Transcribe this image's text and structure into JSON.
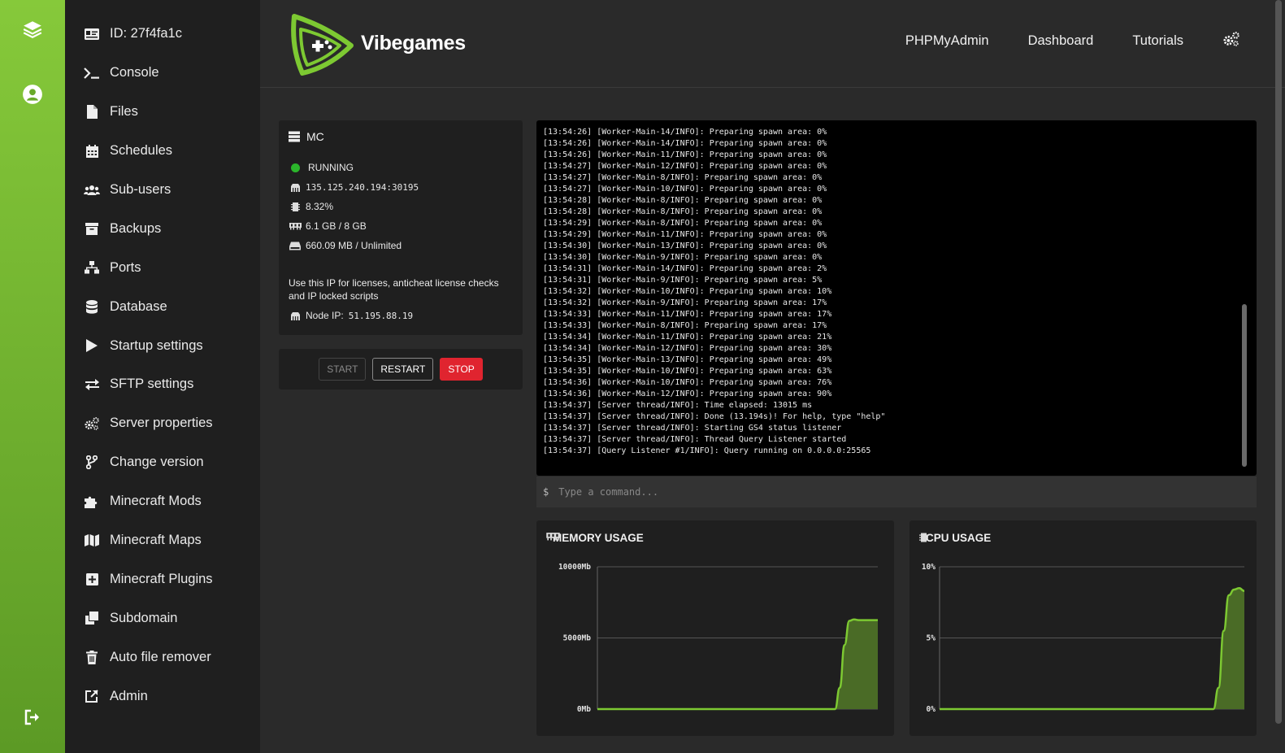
{
  "rail": {
    "icons": [
      "layers-icon",
      "user-circle-icon",
      "logout-icon"
    ]
  },
  "sidebar": {
    "items": [
      {
        "label": "ID: 27f4fa1c",
        "icon": "id-card-icon"
      },
      {
        "label": "Console",
        "icon": "terminal-icon"
      },
      {
        "label": "Files",
        "icon": "file-icon"
      },
      {
        "label": "Schedules",
        "icon": "calendar-icon"
      },
      {
        "label": "Sub-users",
        "icon": "users-icon"
      },
      {
        "label": "Backups",
        "icon": "archive-icon"
      },
      {
        "label": "Ports",
        "icon": "network-icon"
      },
      {
        "label": "Database",
        "icon": "database-icon"
      },
      {
        "label": "Startup settings",
        "icon": "play-icon"
      },
      {
        "label": "SFTP settings",
        "icon": "exchange-icon"
      },
      {
        "label": "Server properties",
        "icon": "gears-icon"
      },
      {
        "label": "Change version",
        "icon": "branch-icon"
      },
      {
        "label": "Minecraft Mods",
        "icon": "puzzle-icon"
      },
      {
        "label": "Minecraft Maps",
        "icon": "map-icon"
      },
      {
        "label": "Minecraft Plugins",
        "icon": "plus-square-icon"
      },
      {
        "label": "Subdomain",
        "icon": "clone-icon"
      },
      {
        "label": "Auto file remover",
        "icon": "trash-icon"
      },
      {
        "label": "Admin",
        "icon": "external-link-icon"
      }
    ]
  },
  "header": {
    "brand": "Vibegames",
    "nav": [
      "PHPMyAdmin",
      "Dashboard",
      "Tutorials"
    ],
    "settings_icon": "gears-icon"
  },
  "server": {
    "name": "MC",
    "status": "RUNNING",
    "status_color": "#2bb52b",
    "address": "135.125.240.194:30195",
    "cpu": "8.32%",
    "memory": "6.1 GB / 8 GB",
    "disk": "660.09 MB / Unlimited",
    "note": "Use this IP for licenses, anticheat license checks and IP locked scripts",
    "node_ip_label": "Node IP:",
    "node_ip": "51.195.88.19"
  },
  "controls": {
    "start": "START",
    "restart": "RESTART",
    "stop": "STOP"
  },
  "console": {
    "lines": [
      "[13:54:26] [Worker-Main-14/INFO]: Preparing spawn area: 0%",
      "[13:54:26] [Worker-Main-14/INFO]: Preparing spawn area: 0%",
      "[13:54:26] [Worker-Main-11/INFO]: Preparing spawn area: 0%",
      "[13:54:27] [Worker-Main-12/INFO]: Preparing spawn area: 0%",
      "[13:54:27] [Worker-Main-8/INFO]: Preparing spawn area: 0%",
      "[13:54:27] [Worker-Main-10/INFO]: Preparing spawn area: 0%",
      "[13:54:28] [Worker-Main-8/INFO]: Preparing spawn area: 0%",
      "[13:54:28] [Worker-Main-8/INFO]: Preparing spawn area: 0%",
      "[13:54:29] [Worker-Main-8/INFO]: Preparing spawn area: 0%",
      "[13:54:29] [Worker-Main-11/INFO]: Preparing spawn area: 0%",
      "[13:54:30] [Worker-Main-13/INFO]: Preparing spawn area: 0%",
      "[13:54:30] [Worker-Main-9/INFO]: Preparing spawn area: 0%",
      "[13:54:31] [Worker-Main-14/INFO]: Preparing spawn area: 2%",
      "[13:54:31] [Worker-Main-9/INFO]: Preparing spawn area: 5%",
      "[13:54:32] [Worker-Main-10/INFO]: Preparing spawn area: 10%",
      "[13:54:32] [Worker-Main-9/INFO]: Preparing spawn area: 17%",
      "[13:54:33] [Worker-Main-11/INFO]: Preparing spawn area: 17%",
      "[13:54:33] [Worker-Main-8/INFO]: Preparing spawn area: 17%",
      "[13:54:34] [Worker-Main-11/INFO]: Preparing spawn area: 21%",
      "[13:54:34] [Worker-Main-12/INFO]: Preparing spawn area: 30%",
      "[13:54:35] [Worker-Main-13/INFO]: Preparing spawn area: 49%",
      "[13:54:35] [Worker-Main-10/INFO]: Preparing spawn area: 63%",
      "[13:54:36] [Worker-Main-10/INFO]: Preparing spawn area: 76%",
      "[13:54:36] [Worker-Main-12/INFO]: Preparing spawn area: 90%",
      "[13:54:37] [Server thread/INFO]: Time elapsed: 13015 ms",
      "[13:54:37] [Server thread/INFO]: Done (13.194s)! For help, type \"help\"",
      "[13:54:37] [Server thread/INFO]: Starting GS4 status listener",
      "[13:54:37] [Server thread/INFO]: Thread Query Listener started",
      "[13:54:37] [Query Listener #1/INFO]: Query running on 0.0.0.0:25565"
    ],
    "prompt": "$",
    "placeholder": "Type a command..."
  },
  "memory_chart": {
    "title": "MEMORY USAGE",
    "icon": "memory-icon",
    "y_ticks": [
      "10000Mb",
      "5000Mb",
      "0Mb"
    ],
    "ylim": [
      0,
      10000
    ],
    "values": [
      0,
      0,
      0,
      0,
      0,
      0,
      0,
      0,
      0,
      0,
      0,
      0,
      0,
      0,
      0,
      0,
      0,
      0,
      0,
      0,
      0,
      0,
      0,
      0,
      0,
      0,
      0,
      0,
      0,
      0,
      0,
      0,
      0,
      0,
      0,
      0,
      0,
      0,
      0,
      0,
      0,
      0,
      0,
      0,
      0,
      0,
      0,
      0,
      0,
      0,
      0,
      1500,
      4500,
      6200,
      6300,
      6250,
      6250,
      6250,
      6250,
      6250
    ],
    "color": "#7dc932"
  },
  "cpu_chart": {
    "title": "CPU USAGE",
    "icon": "cpu-icon",
    "y_ticks": [
      "10%",
      "5%",
      "0%"
    ],
    "ylim": [
      0,
      10
    ],
    "values": [
      0,
      0,
      0,
      0,
      0,
      0,
      0,
      0,
      0,
      0,
      0,
      0,
      0,
      0,
      0,
      0,
      0,
      0,
      0,
      0,
      0,
      0,
      0,
      0,
      0,
      0,
      0,
      0,
      0,
      0,
      0,
      0,
      0,
      0,
      0,
      0,
      0,
      0,
      0,
      0,
      0,
      0,
      0,
      0,
      0,
      0,
      0,
      0,
      0,
      0,
      0,
      0,
      0,
      0,
      1.5,
      5.5,
      8.0,
      8.4,
      8.5,
      8.3
    ],
    "color": "#7dc932"
  }
}
